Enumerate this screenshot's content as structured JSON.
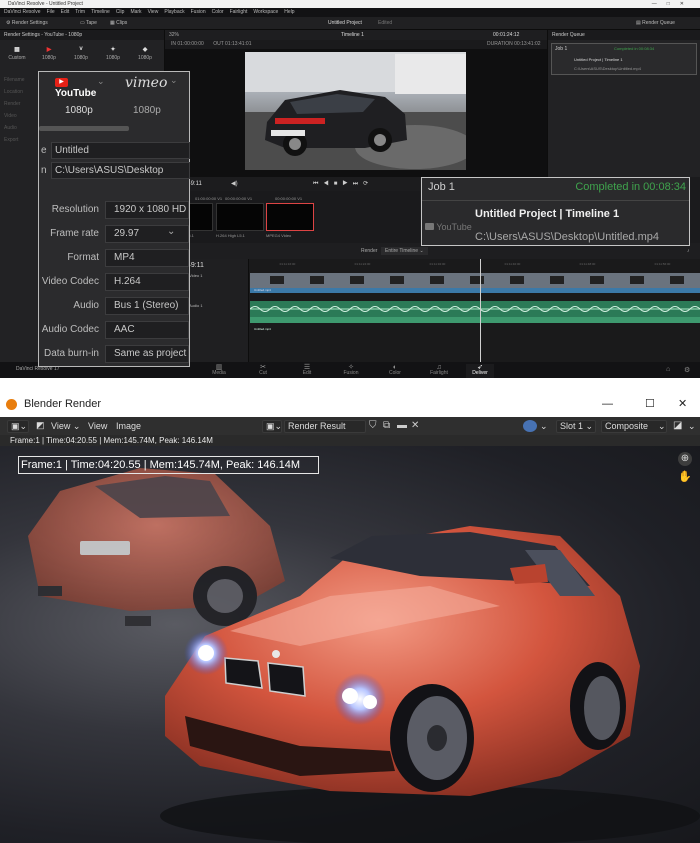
{
  "resolve": {
    "window_title": "DaVinci Resolve - Untitled Project",
    "window_controls": [
      "—",
      "□",
      "✕"
    ],
    "menu": [
      "DaVinci Resolve",
      "File",
      "Edit",
      "Trim",
      "Timeline",
      "Clip",
      "Mark",
      "View",
      "Playback",
      "Fusion",
      "Color",
      "Fairlight",
      "Workspace",
      "Help"
    ],
    "toolbar": {
      "render_settings": "Render Settings",
      "tape": "Tape",
      "clips": "Clips",
      "project_name": "Untitled Project",
      "project_status": "Edited",
      "render_queue": "Render Queue",
      "zoom": "32%",
      "timeline_name": "Timeline 1",
      "timecode_top": "00:01:24:12"
    },
    "left_panel_title": "Render Settings - YouTube - 1080p",
    "preset_labels": [
      "Custom",
      "1080p",
      "1080p",
      "1080p",
      "1080p"
    ],
    "faint_labels": [
      "Filename",
      "Location",
      "Render",
      "Video",
      "Audio",
      "Export"
    ],
    "viewer_in": "IN  01:00:00:00",
    "viewer_out": "OUT  01:13:41:01",
    "viewer_duration": "DURATION  00:13:41:02",
    "timecode_main": "01:11:49:11",
    "timecode_timeline": "01:11:49:11",
    "clip_labels": [
      "H.264 High L5.1",
      "H.264 High L5.1",
      "MPEG4 Video"
    ],
    "clip_timecodes": [
      "01:00:00:00",
      "00:00:00:00",
      "00:00:00:00"
    ],
    "clip_tracks": [
      "V1",
      "V1",
      "V1"
    ],
    "timeline_bar": {
      "render": "Render",
      "range": "Entire Timeline"
    },
    "track_labels": [
      "Video 1",
      "Audio 1"
    ],
    "track_clip_label": "Untitled.mp4",
    "ruler_ticks": [
      "01:11:16:00",
      "01:11:24:00",
      "01:11:32:00",
      "01:11:40:00",
      "01:11:48:00",
      "01:11:56:00"
    ],
    "queue": {
      "title": "Render Queue",
      "job": "Job 1",
      "job_status": "Completed in 00:08:34",
      "job_name": "Untitled Project | Timeline 1",
      "job_path": "C:\\Users\\ASUS\\Desktop\\Untitled.mp4"
    },
    "pages": [
      "Media",
      "Cut",
      "Edit",
      "Fusion",
      "Color",
      "Fairlight",
      "Deliver"
    ],
    "active_page": "Deliver",
    "app_version": "DaVinci Resolve 17",
    "zoom_settings": {
      "youtube": "YouTube",
      "vimeo": "vimeo",
      "res_left": "1080p",
      "res_right": "1080p",
      "partial_filename": "e",
      "partial_location": "n",
      "filename": "Untitled",
      "location": "C:\\Users\\ASUS\\Desktop",
      "rows": [
        {
          "label": "Resolution",
          "value": "1920 x 1080 HD"
        },
        {
          "label": "Frame rate",
          "value": "29.97"
        },
        {
          "label": "Format",
          "value": "MP4"
        },
        {
          "label": "Video Codec",
          "value": "H.264"
        },
        {
          "label": "Audio",
          "value": "Bus 1 (Stereo)"
        },
        {
          "label": "Audio Codec",
          "value": "AAC"
        },
        {
          "label": "Data burn-in",
          "value": "Same as project"
        }
      ]
    },
    "zoom_job": {
      "job": "Job 1",
      "status": "Completed in 00:08:34",
      "name": "Untitled Project | Timeline 1",
      "path": "C:\\Users\\ASUS\\Desktop\\Untitled.mp4",
      "logo": "YouTube"
    },
    "colors": {
      "accent_green": "#3fa34d",
      "video_track": "#3b79a8",
      "audio_track": "#2b7a57"
    }
  },
  "blender": {
    "window_title": "Blender Render",
    "window_controls": [
      "—",
      "☐",
      "✕"
    ],
    "menu": [
      "View",
      "View",
      "Image"
    ],
    "image_name": "Render Result",
    "slot": "Slot 1",
    "pass": "Composite",
    "info_line": "Frame:1 | Time:04:20.55 | Mem:145.74M, Peak: 146.14M",
    "overlay_text": "Frame:1 | Time:04:20.55 | Mem:145.74M, Peak: 146.14M",
    "car_plate": "",
    "colors": {
      "car": "#c9533c",
      "background": "#2a2b31"
    }
  }
}
